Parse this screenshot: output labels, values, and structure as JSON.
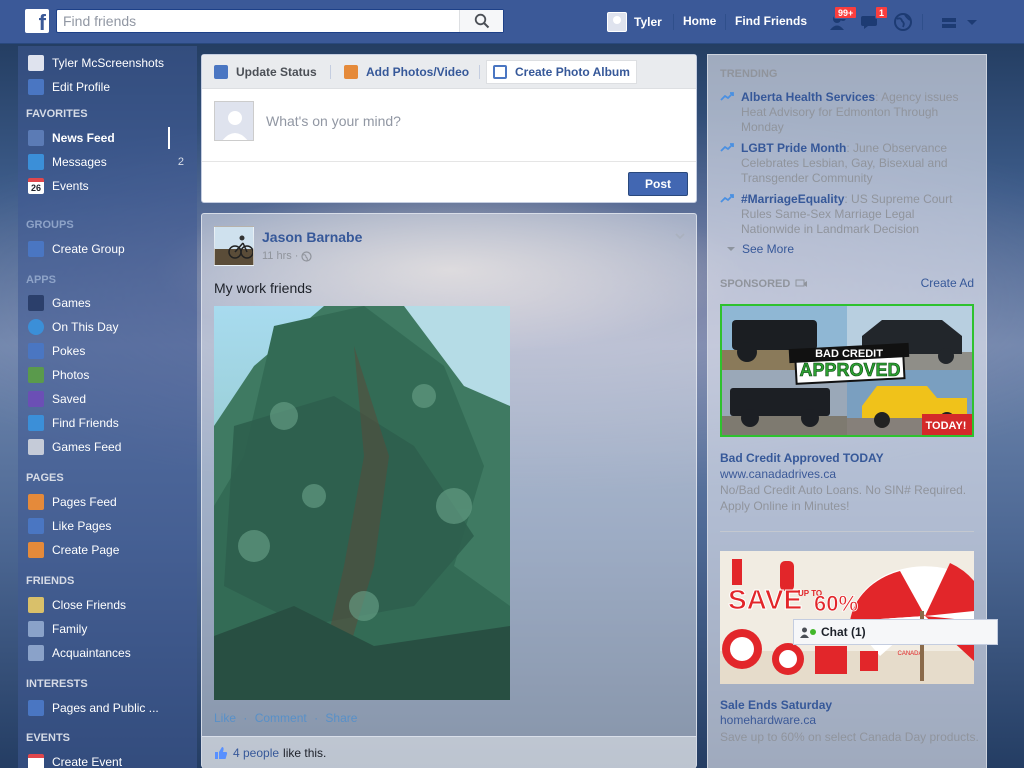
{
  "colors": {
    "brand_blue": "#3b5998",
    "link_blue": "#365899",
    "button_blue": "#4267b2",
    "notification_red": "#fa3e3e",
    "ad_border_green": "#2ec22e",
    "online_green": "#42b72a"
  },
  "topbar": {
    "logo_icon": "facebook-f-icon",
    "search_placeholder": "Find friends",
    "search_icon": "magnifier-icon",
    "user_name": "Tyler",
    "home_label": "Home",
    "find_friends_label": "Find Friends",
    "friend_requests_badge": "99+",
    "messages_badge": "1",
    "icons": [
      "friend-requests-icon",
      "messages-icon",
      "globe-icon",
      "privacy-shortcuts-icon",
      "account-caret-icon"
    ]
  },
  "leftnav": {
    "profile_name": "Tyler McScreenshots",
    "edit_profile": "Edit Profile",
    "favorites_header": "FAVORITES",
    "news_feed": "News Feed",
    "messages": "Messages",
    "messages_count": "2",
    "events": "Events",
    "events_day": "26",
    "groups_header": "GROUPS",
    "create_group": "Create Group",
    "apps_header": "APPS",
    "games": "Games",
    "on_this_day": "On This Day",
    "pokes": "Pokes",
    "photos": "Photos",
    "saved": "Saved",
    "find_friends": "Find Friends",
    "games_feed": "Games Feed",
    "pages_header": "PAGES",
    "pages_feed": "Pages Feed",
    "like_pages": "Like Pages",
    "create_page": "Create Page",
    "friends_header": "FRIENDS",
    "close_friends": "Close Friends",
    "family": "Family",
    "acquaintances": "Acquaintances",
    "interests_header": "INTERESTS",
    "pages_and_public": "Pages and Public ...",
    "events_header": "EVENTS",
    "create_event": "Create Event"
  },
  "composer": {
    "tab_update_status": "Update Status",
    "tab_add_photos": "Add Photos/Video",
    "tab_create_album": "Create Photo Album",
    "placeholder": "What's on your mind?",
    "post_label": "Post"
  },
  "story": {
    "author": "Jason Barnabe",
    "time": "11 hrs",
    "privacy_icon": "public-globe-icon",
    "text": "My work friends",
    "photo_subject": "evergreen-tree-photo",
    "action_like": "Like",
    "action_comment": "Comment",
    "action_share": "Share",
    "likes_count": "4 people",
    "likes_suffix": "like this."
  },
  "rightcol": {
    "trending_header": "TRENDING",
    "trends": [
      {
        "topic": "Alberta Health Services",
        "desc": ": Agency issues Heat Advisory for Edmonton Through Monday"
      },
      {
        "topic": "LGBT Pride Month",
        "desc": ": June Observance Celebrates Lesbian, Gay, Bisexual and Transgender Community"
      },
      {
        "topic": "#MarriageEquality",
        "desc": ": US Supreme Court Rules Same-Sex Marriage Legal Nationwide in Landmark Decision"
      }
    ],
    "see_more": "See More",
    "sponsored_header": "SPONSORED",
    "create_ad": "Create Ad",
    "ad1": {
      "banner_line1": "BAD CREDIT",
      "banner_line2": "APPROVED",
      "banner_corner": "TODAY!",
      "title": "Bad Credit Approved TODAY",
      "url": "www.canadadrives.ca",
      "desc": "No/Bad Credit Auto Loans. No SIN# Required. Apply Online in Minutes!"
    },
    "ad2": {
      "banner_save": "SAVE",
      "banner_up_to": "UP TO",
      "banner_percent": "60%",
      "umbrella_text": "CANADA",
      "title": "Sale Ends Saturday",
      "url": "homehardware.ca",
      "desc": "Save up to 60% on select Canada Day products."
    }
  },
  "chat": {
    "label": "Chat (1)"
  }
}
